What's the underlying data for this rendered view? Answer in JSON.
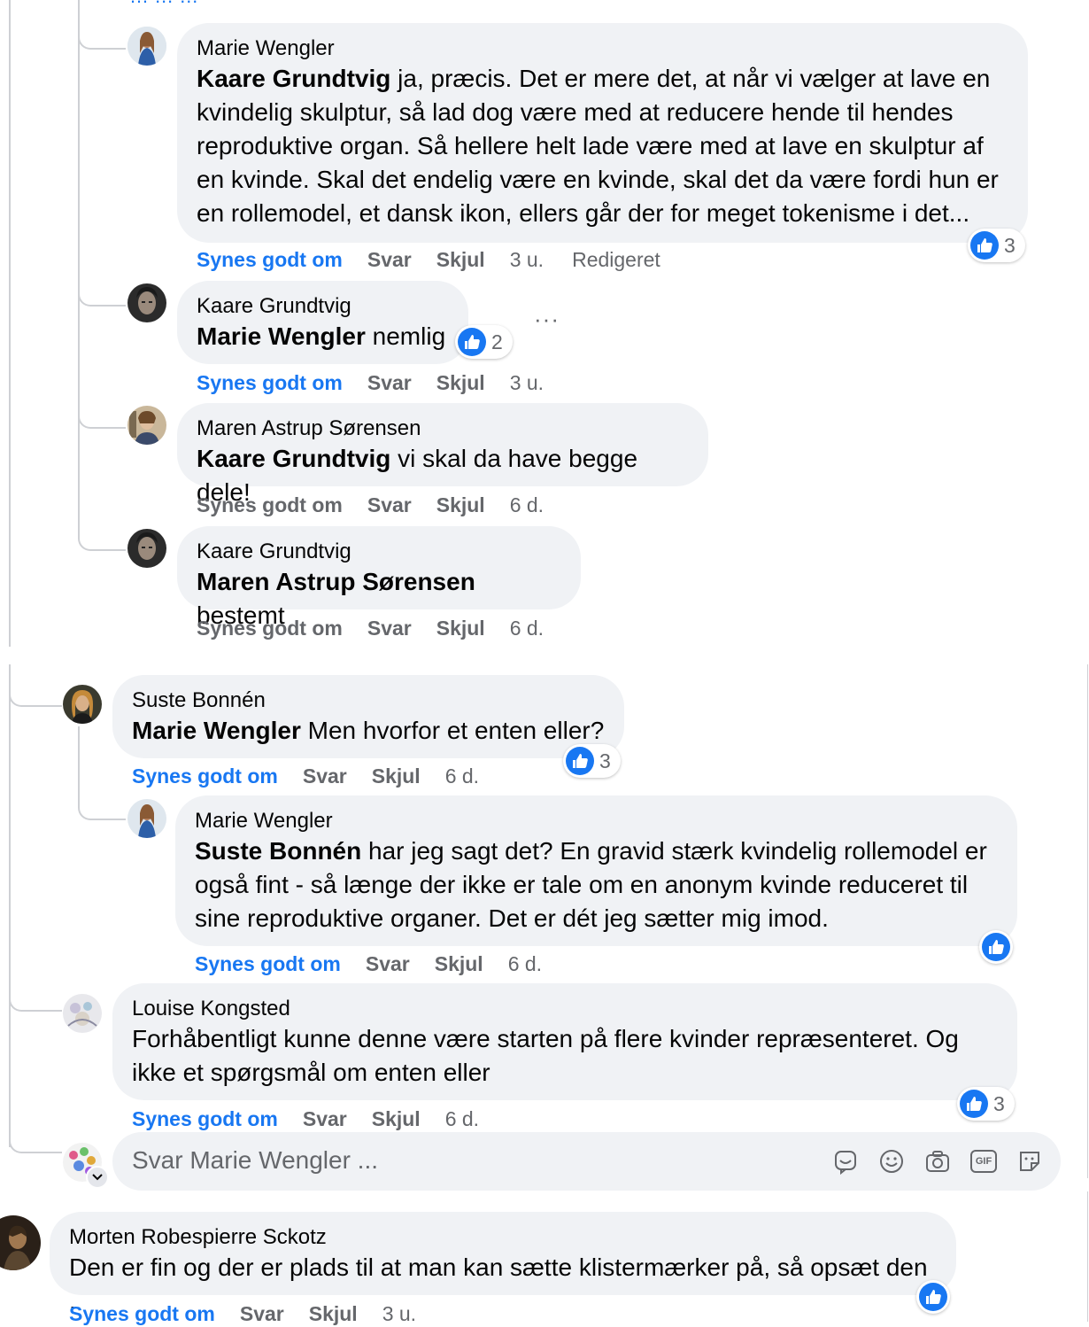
{
  "thread_top": {
    "partial_text": "… … …",
    "comments": [
      {
        "author": "Marie Wengler",
        "mention": "Kaare Grundtvig",
        "text": " ja, præcis. Det er mere det, at når vi vælger at lave en kvindelig skulptur, så lad dog være med at reducere hende til hendes reproduktive organ. Så hellere helt lade være med at lave en skulptur af en kvinde. Skal det endelig være en kvinde, skal det da være fordi hun er en rollemodel, et dansk ikon, ellers går der for meget tokenisme i det...",
        "like": "Synes godt om",
        "reply": "Svar",
        "hide": "Skjul",
        "time": "3 u.",
        "edited": "Redigeret",
        "reactions": "3"
      },
      {
        "author": "Kaare Grundtvig",
        "mention": "Marie Wengler",
        "text": " nemlig",
        "like": "Synes godt om",
        "reply": "Svar",
        "hide": "Skjul",
        "time": "3 u.",
        "reactions": "2",
        "more": "···"
      },
      {
        "author": "Maren Astrup Sørensen",
        "mention": "Kaare Grundtvig",
        "text": " vi skal da have begge dele!",
        "like": "Synes godt om",
        "reply": "Svar",
        "hide": "Skjul",
        "time": "6 d."
      },
      {
        "author": "Kaare Grundtvig",
        "mention": "Maren Astrup Sørensen",
        "text": " bestemt",
        "like": "Synes godt om",
        "reply": "Svar",
        "hide": "Skjul",
        "time": "6 d."
      }
    ]
  },
  "thread_mid": {
    "comments": [
      {
        "author": "Suste Bonnén",
        "mention": "Marie Wengler",
        "text": " Men hvorfor et enten eller?",
        "like": "Synes godt om",
        "reply": "Svar",
        "hide": "Skjul",
        "time": "6 d.",
        "reactions": "3"
      },
      {
        "author": "Marie Wengler",
        "mention": "Suste Bonnén",
        "text": " har jeg sagt det? En gravid stærk kvindelig rollemodel er også fint - så længe der ikke er tale om en anonym kvinde reduceret til sine reproduktive organer. Det er dét jeg sætter mig imod.",
        "like": "Synes godt om",
        "reply": "Svar",
        "hide": "Skjul",
        "time": "6 d."
      },
      {
        "author": "Louise Kongsted",
        "text": "Forhåbentligt kunne denne være starten på flere kvinder repræsenteret. Og ikke et spørgsmål om enten eller",
        "like": "Synes godt om",
        "reply": "Svar",
        "hide": "Skjul",
        "time": "6 d.",
        "reactions": "3"
      }
    ],
    "reply_box": {
      "placeholder": "Svar Marie Wengler ...",
      "tools": [
        "sticker-icon",
        "emoji-icon",
        "camera-icon",
        "gif-icon",
        "avatar-sticker-icon"
      ],
      "gif_label": "GIF"
    }
  },
  "bottom": {
    "author": "Morten Robespierre Sckotz",
    "text": "Den er fin og der er plads til at man kan sætte klistermærker på, så opsæt den .",
    "like": "Synes godt om",
    "reply": "Svar",
    "hide": "Skjul",
    "time": "3 u."
  },
  "colors": {
    "accent": "#1877f2",
    "bubble": "#f0f2f5",
    "muted": "#65676b",
    "line": "#ced0d4"
  }
}
